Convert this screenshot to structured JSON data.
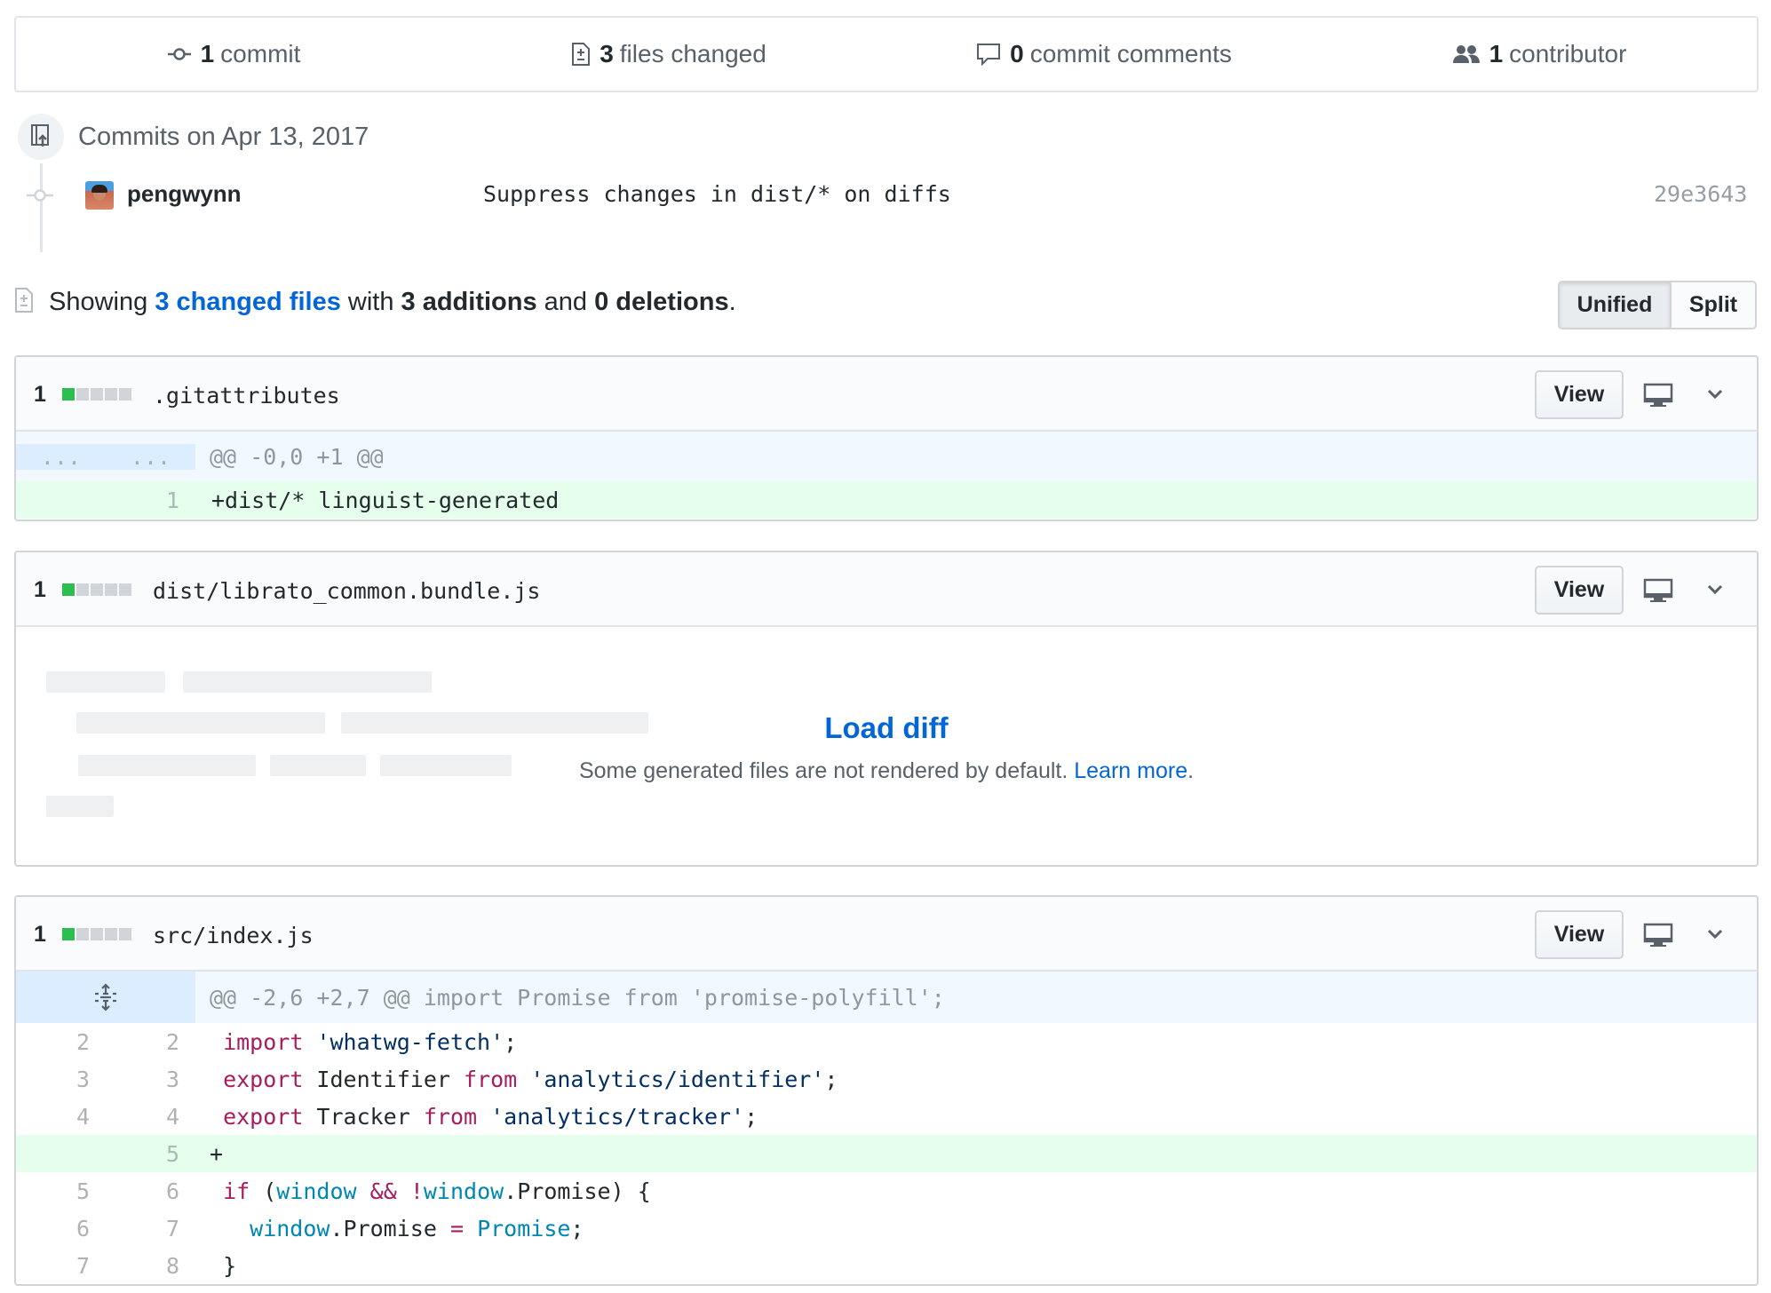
{
  "summary": {
    "commits_count": "1",
    "commits_label": "commit",
    "files_count": "3",
    "files_label": "files changed",
    "comments_count": "0",
    "comments_label": "commit comments",
    "contributors_count": "1",
    "contributors_label": "contributor"
  },
  "commit_group": {
    "date_label": "Commits on Apr 13, 2017",
    "commit": {
      "author": "pengwynn",
      "message": "Suppress changes in dist/* on diffs",
      "sha": "29e3643"
    }
  },
  "toc": {
    "prefix": "Showing ",
    "files_link": "3 changed files",
    "mid1": " with ",
    "additions": "3 additions",
    "mid2": " and ",
    "deletions": "0 deletions",
    "suffix": "."
  },
  "view_toggle": {
    "unified": "Unified",
    "split": "Split"
  },
  "files": [
    {
      "count": "1",
      "name": ".gitattributes",
      "view_label": "View",
      "hunk": {
        "left": "...",
        "right": "...",
        "text": "@@ -0,0 +1 @@"
      },
      "add_line": {
        "right": "1",
        "text": "+dist/* linguist-generated"
      }
    },
    {
      "count": "1",
      "name": "dist/librato_common.bundle.js",
      "view_label": "View",
      "load_diff": "Load diff",
      "note": "Some generated files are not rendered by default. ",
      "learn_more": "Learn more",
      "note_end": "."
    },
    {
      "count": "1",
      "name": "src/index.js",
      "view_label": "View",
      "hunk": {
        "text": "@@ -2,6 +2,7 @@ import Promise from 'promise-polyfill';"
      },
      "lines": [
        {
          "left": "2",
          "right": "2",
          "type": "ctx"
        },
        {
          "left": "3",
          "right": "3",
          "type": "ctx"
        },
        {
          "left": "4",
          "right": "4",
          "type": "ctx"
        },
        {
          "left": "",
          "right": "5",
          "type": "add"
        },
        {
          "left": "5",
          "right": "6",
          "type": "ctx"
        },
        {
          "left": "6",
          "right": "7",
          "type": "ctx"
        },
        {
          "left": "7",
          "right": "8",
          "type": "ctx"
        }
      ],
      "code": {
        "l1_kw": "import",
        "l1_str": "'whatwg-fetch'",
        "l1_end": ";",
        "l2_kw": "export",
        "l2_id": " Identifier ",
        "l2_from": "from",
        "l2_str": "'analytics/identifier'",
        "l2_end": ";",
        "l3_kw": "export",
        "l3_id": " Tracker ",
        "l3_from": "from",
        "l3_str": "'analytics/tracker'",
        "l3_end": ";",
        "l4": "+",
        "l5_kw": "if",
        "l5_a": " (",
        "l5_w1": "window",
        "l5_and": " && ",
        "l5_not": "!",
        "l5_w2": "window",
        "l5_b": ".Promise) {",
        "l6_w": "window",
        "l6_a": ".Promise ",
        "l6_eq": "=",
        "l6_sp": " ",
        "l6_p": "Promise",
        "l6_end": ";",
        "l7": "}"
      }
    }
  ],
  "colors": {
    "link": "#0366d6",
    "addition": "#2cbe4e",
    "add_bg": "#e6ffed",
    "hunk_bg": "#f1f8ff"
  },
  "icons": [
    "commit-icon",
    "file-diff-icon",
    "comment-icon",
    "people-icon",
    "repo-push-icon",
    "desktop-icon",
    "chevron-down-icon",
    "unfold-icon"
  ]
}
